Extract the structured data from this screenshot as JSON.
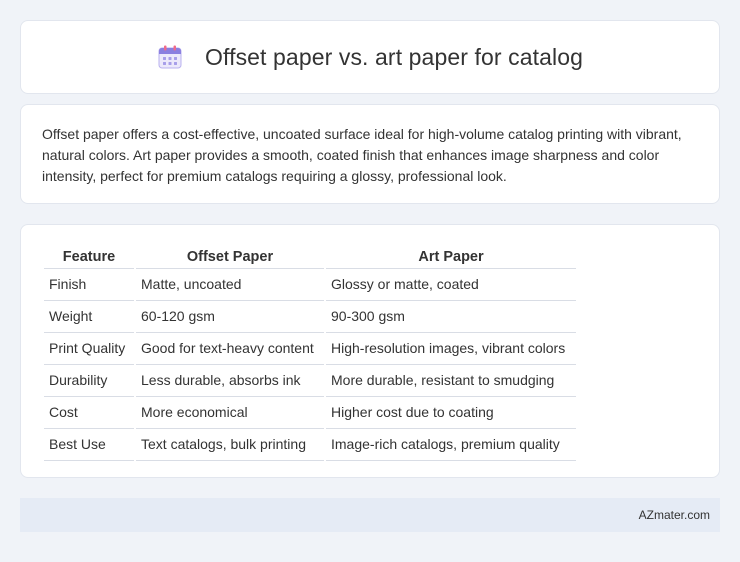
{
  "header": {
    "title": "Offset paper vs. art paper for catalog",
    "icon": "calendar-icon"
  },
  "summary": {
    "text": "Offset paper offers a cost-effective, uncoated surface ideal for high-volume catalog printing with vibrant, natural colors. Art paper provides a smooth, coated finish that enhances image sharpness and color intensity, perfect for premium catalogs requiring a glossy, professional look."
  },
  "table": {
    "headers": [
      "Feature",
      "Offset Paper",
      "Art Paper"
    ],
    "rows": [
      [
        "Finish",
        "Matte, uncoated",
        "Glossy or matte, coated"
      ],
      [
        "Weight",
        "60-120 gsm",
        "90-300 gsm"
      ],
      [
        "Print Quality",
        "Good for text-heavy content",
        "High-resolution images, vibrant colors"
      ],
      [
        "Durability",
        "Less durable, absorbs ink",
        "More durable, resistant to smudging"
      ],
      [
        "Cost",
        "More economical",
        "Higher cost due to coating"
      ],
      [
        "Best Use",
        "Text catalogs, bulk printing",
        "Image-rich catalogs, premium quality"
      ]
    ]
  },
  "footer": {
    "brand": "AZmater.com"
  },
  "colors": {
    "page_bg": "#f0f3f8",
    "card_bg": "#ffffff",
    "footer_bg": "#e5ebf5",
    "icon_accent": "#8a7fe0"
  }
}
